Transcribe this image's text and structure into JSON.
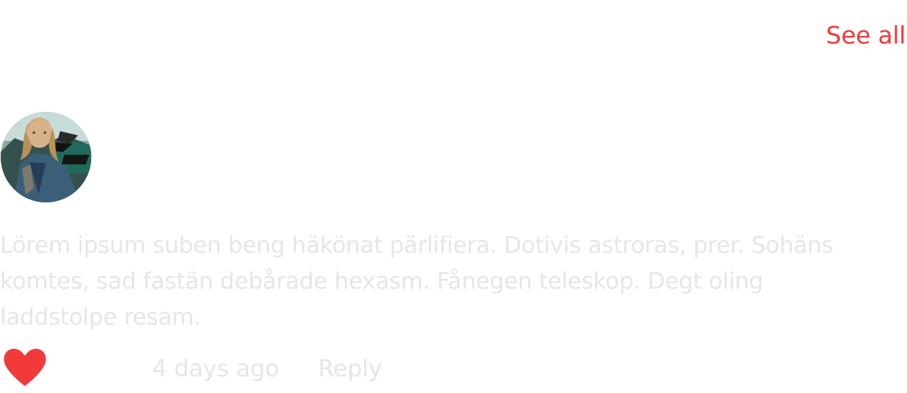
{
  "header": {
    "see_all_label": "See all"
  },
  "comment": {
    "avatar_icon": "user-photo-avatar",
    "text": "Lörem ipsum suben beng häkönat pärlifiera. Dotivis astroras, prer. Sohäns\nkomtes, sad fastän debårade hexasm. Fånegen teleskop. Degt oling\nladdstolpe resam.",
    "timestamp": "4 days ago",
    "reply_label": "Reply",
    "like_icon": "heart-icon",
    "liked": true
  },
  "colors": {
    "accent": "#f23a3a",
    "muted_text": "#e6e6e6",
    "background": "#ffffff"
  }
}
